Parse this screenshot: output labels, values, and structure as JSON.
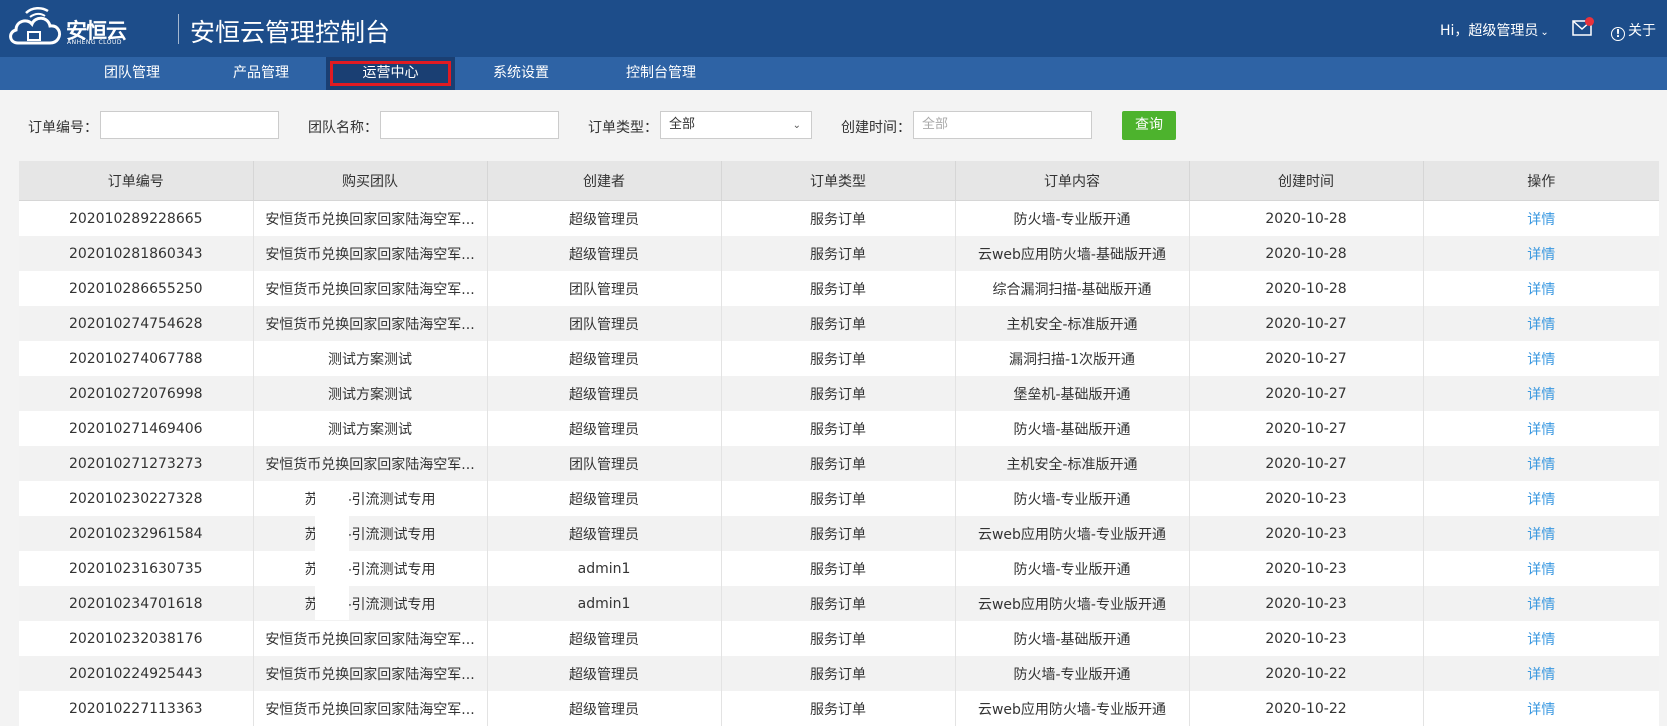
{
  "header": {
    "logo_text": "安恒云",
    "logo_sub": "ANHENG CLOUD",
    "title": "安恒云管理控制台",
    "user": "Hi，超级管理员",
    "about": "关于"
  },
  "nav": {
    "items": [
      {
        "label": "团队管理"
      },
      {
        "label": "产品管理"
      },
      {
        "label": "运营中心"
      },
      {
        "label": "系统设置"
      },
      {
        "label": "控制台管理"
      }
    ],
    "active_index": 2
  },
  "filters": {
    "order_no_label": "订单编号：",
    "order_no_value": "",
    "team_label": "团队名称：",
    "team_value": "",
    "type_label": "订单类型：",
    "type_value": "全部",
    "created_label": "创建时间：",
    "created_placeholder": "全部",
    "query_button": "查询"
  },
  "table": {
    "columns": [
      "订单编号",
      "购买团队",
      "创建者",
      "订单类型",
      "订单内容",
      "创建时间",
      "操作"
    ],
    "rows": [
      [
        "202010289228665",
        "安恒货币兑换回家回家陆海空军...",
        "超级管理员",
        "服务订单",
        "防火墙-专业版开通",
        "2020-10-28",
        "详情"
      ],
      [
        "202010281860343",
        "安恒货币兑换回家回家陆海空军...",
        "超级管理员",
        "服务订单",
        "云web应用防火墙-基础版开通",
        "2020-10-28",
        "详情"
      ],
      [
        "202010286655250",
        "安恒货币兑换回家回家陆海空军...",
        "团队管理员",
        "服务订单",
        "综合漏洞扫描-基础版开通",
        "2020-10-28",
        "详情"
      ],
      [
        "202010274754628",
        "安恒货币兑换回家回家陆海空军...",
        "团队管理员",
        "服务订单",
        "主机安全-标准版开通",
        "2020-10-27",
        "详情"
      ],
      [
        "202010274067788",
        "测试方案测试",
        "超级管理员",
        "服务订单",
        "漏洞扫描-1次版开通",
        "2020-10-27",
        "详情"
      ],
      [
        "202010272076998",
        "测试方案测试",
        "超级管理员",
        "服务订单",
        "堡垒机-基础版开通",
        "2020-10-27",
        "详情"
      ],
      [
        "202010271469406",
        "测试方案测试",
        "超级管理员",
        "服务订单",
        "防火墙-基础版开通",
        "2020-10-27",
        "详情"
      ],
      [
        "202010271273273",
        "安恒货币兑换回家回家陆海空军...",
        "团队管理员",
        "服务订单",
        "主机安全-标准版开通",
        "2020-10-27",
        "详情"
      ],
      [
        "202010230227328",
        "苏　　-引流测试专用",
        "超级管理员",
        "服务订单",
        "防火墙-专业版开通",
        "2020-10-23",
        "详情"
      ],
      [
        "202010232961584",
        "苏　　-引流测试专用",
        "超级管理员",
        "服务订单",
        "云web应用防火墙-专业版开通",
        "2020-10-23",
        "详情"
      ],
      [
        "202010231630735",
        "苏　　-引流测试专用",
        "admin1",
        "服务订单",
        "防火墙-专业版开通",
        "2020-10-23",
        "详情"
      ],
      [
        "202010234701618",
        "苏　　-引流测试专用",
        "admin1",
        "服务订单",
        "云web应用防火墙-专业版开通",
        "2020-10-23",
        "详情"
      ],
      [
        "202010232038176",
        "安恒货币兑换回家回家陆海空军...",
        "超级管理员",
        "服务订单",
        "防火墙-基础版开通",
        "2020-10-23",
        "详情"
      ],
      [
        "202010224925443",
        "安恒货币兑换回家回家陆海空军...",
        "超级管理员",
        "服务订单",
        "防火墙-专业版开通",
        "2020-10-22",
        "详情"
      ],
      [
        "202010227113363",
        "安恒货币兑换回家回家陆海空军...",
        "超级管理员",
        "服务订单",
        "云web应用防火墙-专业版开通",
        "2020-10-22",
        "详情"
      ]
    ]
  },
  "colors": {
    "header_bg": "#1d4d8a",
    "nav_bg": "#2e63a5",
    "nav_active_bg": "#1a3f73",
    "highlight_border": "#e11b22",
    "query_button": "#4db32d",
    "link": "#3a98e0",
    "notification_dot": "#e8323c"
  },
  "icons": [
    "cloud-logo-icon",
    "chevron-down-icon",
    "mail-icon",
    "info-icon"
  ]
}
